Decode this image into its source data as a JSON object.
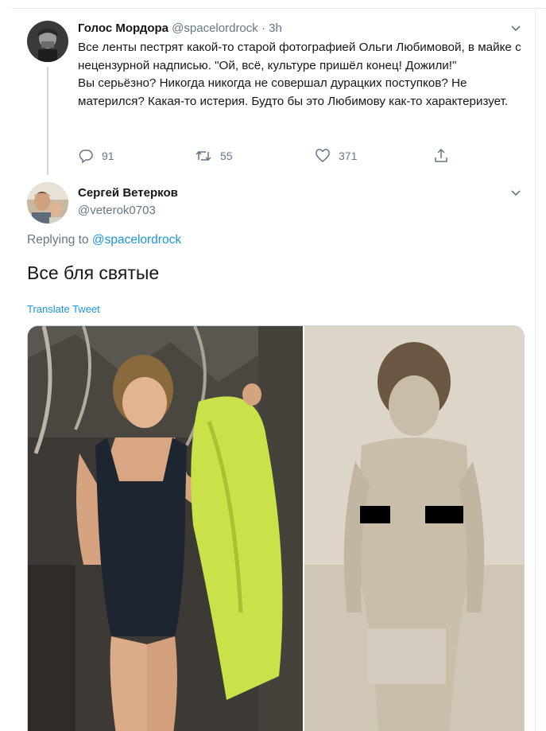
{
  "tweet1": {
    "author_name": "Голос Мордора",
    "author_handle": "@spacelordrock",
    "separator": "·",
    "time": "3h",
    "text_lines": [
      "Все ленты пестрят какой-то старой фотографией Ольги Любимовой, в майке с нецензурной надписью. \"Ой, всё, культуре пришёл конец! Дожили!\"",
      "Вы серьёзно? Никогда никогда не совершал дурацких поступков? Не матерился? Какая-то истерия. Будто бы это Любимову как-то характеризует."
    ],
    "actions": {
      "reply_count": "91",
      "retweet_count": "55",
      "like_count": "371"
    },
    "icons": [
      "reply-icon",
      "retweet-icon",
      "like-icon",
      "share-icon",
      "chevron-down-icon"
    ]
  },
  "tweet2": {
    "author_name": "Сергей Ветерков",
    "author_handle": "@veterok0703",
    "replying_prefix": "Replying to",
    "replying_to": "@spacelordrock",
    "text": "Все бля святые",
    "translate_label": "Translate Tweet",
    "media": {
      "left_photo_desc_color": "#c9e24a",
      "right_photo_desc_color": "#d8d0c2"
    }
  },
  "colors": {
    "text_primary": "#14171a",
    "text_secondary": "#657786",
    "link_blue": "#1b95e0",
    "border": "#e6ecf0"
  }
}
